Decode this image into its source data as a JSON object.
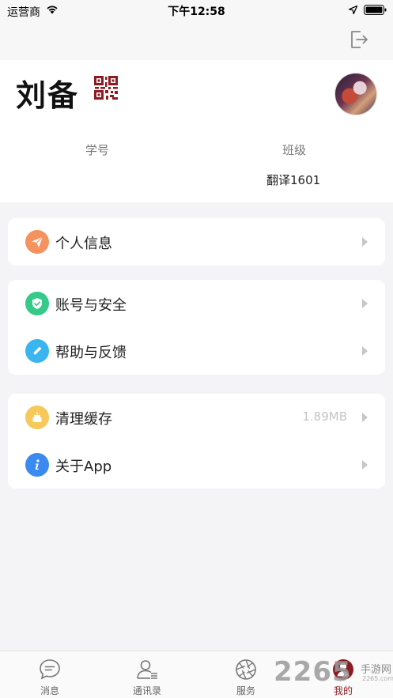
{
  "status_bar": {
    "carrier": "运营商",
    "time": "下午12:58"
  },
  "profile": {
    "name": "刘备",
    "student_id_label": "学号",
    "student_id_value": "",
    "class_label": "班级",
    "class_value": "翻译1601"
  },
  "menu_groups": [
    {
      "items": [
        {
          "label": "个人信息",
          "icon": "paper-plane-icon",
          "color": "#f5925f"
        }
      ]
    },
    {
      "items": [
        {
          "label": "账号与安全",
          "icon": "shield-check-icon",
          "color": "#35c98a"
        },
        {
          "label": "帮助与反馈",
          "icon": "pencil-icon",
          "color": "#3ab5ef"
        }
      ]
    },
    {
      "items": [
        {
          "label": "清理缓存",
          "value": "1.89MB",
          "icon": "cake-icon",
          "color": "#f7c85a"
        },
        {
          "label": "关于App",
          "icon": "info-icon",
          "color": "#3a8af0"
        }
      ]
    }
  ],
  "tab_bar": {
    "tabs": [
      {
        "label": "消息",
        "icon": "chat-bubble-icon"
      },
      {
        "label": "通讯录",
        "icon": "contacts-icon"
      },
      {
        "label": "服务",
        "icon": "aperture-icon"
      },
      {
        "label": "我的",
        "icon": "person-icon",
        "active": true
      }
    ]
  },
  "watermark": {
    "digits": "2265",
    "text": "手游网",
    "url": "2265.com"
  },
  "colors": {
    "accent": "#8b1c24",
    "background": "#f4f4f6"
  }
}
